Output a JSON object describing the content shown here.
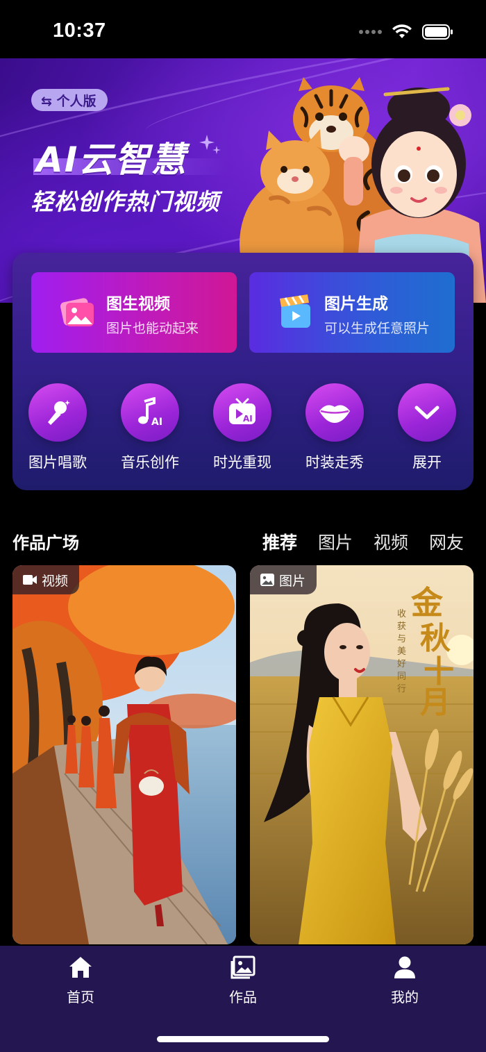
{
  "status_bar": {
    "time": "10:37"
  },
  "banner": {
    "badge": "⇆ 个人版",
    "title": "AI云智慧",
    "subtitle": "轻松创作热门视频"
  },
  "features": [
    {
      "title": "图生视频",
      "desc": "图片也能动起来",
      "icon": "image-photo-icon"
    },
    {
      "title": "图片生成",
      "desc": "可以生成任意照片",
      "icon": "clapperboard-icon"
    }
  ],
  "tools": [
    {
      "label": "图片唱歌",
      "icon": "microphone-icon"
    },
    {
      "label": "音乐创作",
      "icon": "music-note-ai-icon"
    },
    {
      "label": "时光重现",
      "icon": "tv-play-ai-icon"
    },
    {
      "label": "时装走秀",
      "icon": "lips-icon"
    },
    {
      "label": "展开",
      "icon": "chevron-down-icon"
    }
  ],
  "section": {
    "title": "作品广场",
    "tabs": [
      "推荐",
      "图片",
      "视频",
      "网友"
    ],
    "active_tab": "推荐"
  },
  "gallery": [
    {
      "tag": "视频",
      "tag_icon": "video-camera-icon"
    },
    {
      "tag": "图片",
      "tag_icon": "image-icon",
      "overlay_title": "金秋十月",
      "overlay_sub": "收获与美好同行"
    }
  ],
  "bottom_nav": [
    {
      "label": "首页",
      "icon": "home-icon"
    },
    {
      "label": "作品",
      "icon": "gallery-icon"
    },
    {
      "label": "我的",
      "icon": "user-icon"
    }
  ],
  "colors": {
    "accent": "#a01ef0",
    "nav_bg": "#231651",
    "panel_bg": "#33208a"
  }
}
